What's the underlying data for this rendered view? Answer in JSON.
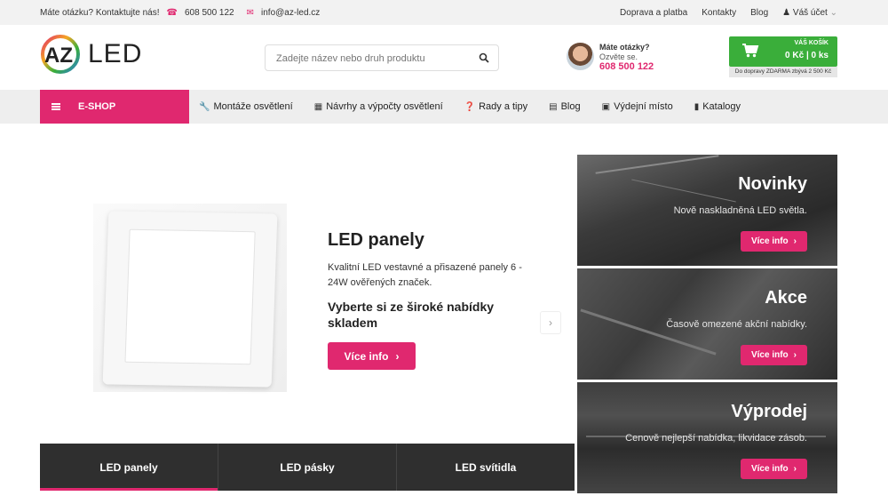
{
  "topbar": {
    "question": "Máte otázku? Kontaktujte nás!",
    "phone": "608 500 122",
    "email": "info@az-led.cz",
    "links": [
      "Doprava a platba",
      "Kontakty",
      "Blog"
    ],
    "account": "Váš účet"
  },
  "header": {
    "logo_text": "LED",
    "search_placeholder": "Zadejte název nebo druh produktu",
    "contact": {
      "question": "Máte otázky?",
      "call": "Ozvěte se.",
      "phone": "608 500 122"
    },
    "cart": {
      "title": "VÁŠ KOŠÍK",
      "summary": "0 Kč | 0 ks",
      "free_shipping": "Do dopravy ZDARMA zbývá 2 500 Kč"
    }
  },
  "nav": {
    "eshop": "E-SHOP",
    "items": [
      {
        "label": "Montáže osvětlení",
        "icon": "wrench-icon"
      },
      {
        "label": "Návrhy a výpočty osvětlení",
        "icon": "calculator-icon"
      },
      {
        "label": "Rady a tipy",
        "icon": "question-icon"
      },
      {
        "label": "Blog",
        "icon": "newspaper-icon"
      },
      {
        "label": "Výdejní místo",
        "icon": "box-icon"
      },
      {
        "label": "Katalogy",
        "icon": "book-icon"
      }
    ]
  },
  "slider": {
    "title": "LED panely",
    "description": "Kvalitní LED vestavné a přisazené panely 6 - 24W ověřených značek.",
    "subtitle": "Vyberte si ze široké nabídky skladem",
    "button": "Více info"
  },
  "tabs": [
    "LED panely",
    "LED pásky",
    "LED svítidla"
  ],
  "promos": [
    {
      "title": "Novinky",
      "description": "Nově naskladněná LED světla.",
      "button": "Více info"
    },
    {
      "title": "Akce",
      "description": "Časově omezené akční nabídky.",
      "button": "Více info"
    },
    {
      "title": "Výprodej",
      "description": "Cenově nejlepší nabídka, likvidace zásob.",
      "button": "Více info"
    }
  ],
  "colors": {
    "accent": "#e0286f",
    "cart": "#3aae3a"
  }
}
